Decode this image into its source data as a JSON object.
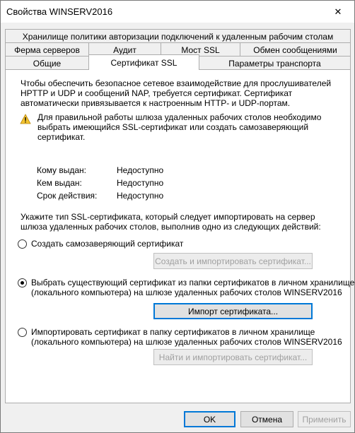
{
  "window": {
    "title": "Свойства WINSERV2016",
    "close_glyph": "✕"
  },
  "tabs": {
    "row1": [
      "Хранилище политики авторизации подключений к удаленным рабочим столам"
    ],
    "row2": [
      "Ферма серверов",
      "Аудит",
      "Мост SSL",
      "Обмен сообщениями"
    ],
    "row3": [
      "Общие",
      "Сертификат SSL",
      "Параметры транспорта"
    ],
    "active": "Сертификат SSL"
  },
  "panel": {
    "intro": [
      "Чтобы обеспечить безопасное сетевое взаимодействие для прослушивателей",
      "HPTTP и UDP и сообщений  NAP, требуется сертификат. Сертификат",
      "автоматически привязывается к настроенным HTTP- и UDP-портам."
    ],
    "warning": [
      "Для правильной работы шлюза удаленных рабочих столов необходимо",
      "выбрать имеющийся SSL-сертификат или создать самозаверяющий",
      "сертификат."
    ],
    "info": [
      {
        "label": "Кому выдан:",
        "value": "Недоступно"
      },
      {
        "label": "Кем выдан:",
        "value": "Недоступно"
      },
      {
        "label": "Срок действия:",
        "value": "Недоступно"
      }
    ],
    "instruction": [
      "Укажите тип SSL-сертификата, который следует импортировать на сервер",
      "шлюза удаленных рабочих столов, выполнив одно из следующих действий:"
    ],
    "options": [
      {
        "label": [
          "Создать самозаверяющий сертификат"
        ],
        "selected": false,
        "button": "Создать и импортировать сертификат...",
        "button_enabled": false
      },
      {
        "label": [
          "Выбрать существующий сертификат из папки сертификатов в личном хранилище",
          "(локального компьютера) на шлюзе удаленных рабочих столов WINSERV2016"
        ],
        "selected": true,
        "button": "Импорт сертификата...",
        "button_enabled": true
      },
      {
        "label": [
          "Импортировать сертификат в папку сертификатов в личном хранилище",
          "(локального компьютера) на шлюзе удаленных рабочих столов WINSERV2016"
        ],
        "selected": false,
        "button": "Найти и импортировать сертификат...",
        "button_enabled": false
      }
    ]
  },
  "footer": {
    "ok": "OK",
    "cancel": "Отмена",
    "apply": "Применить"
  },
  "colors": {
    "focus": "#0078d7",
    "warning": "#f4c430"
  }
}
